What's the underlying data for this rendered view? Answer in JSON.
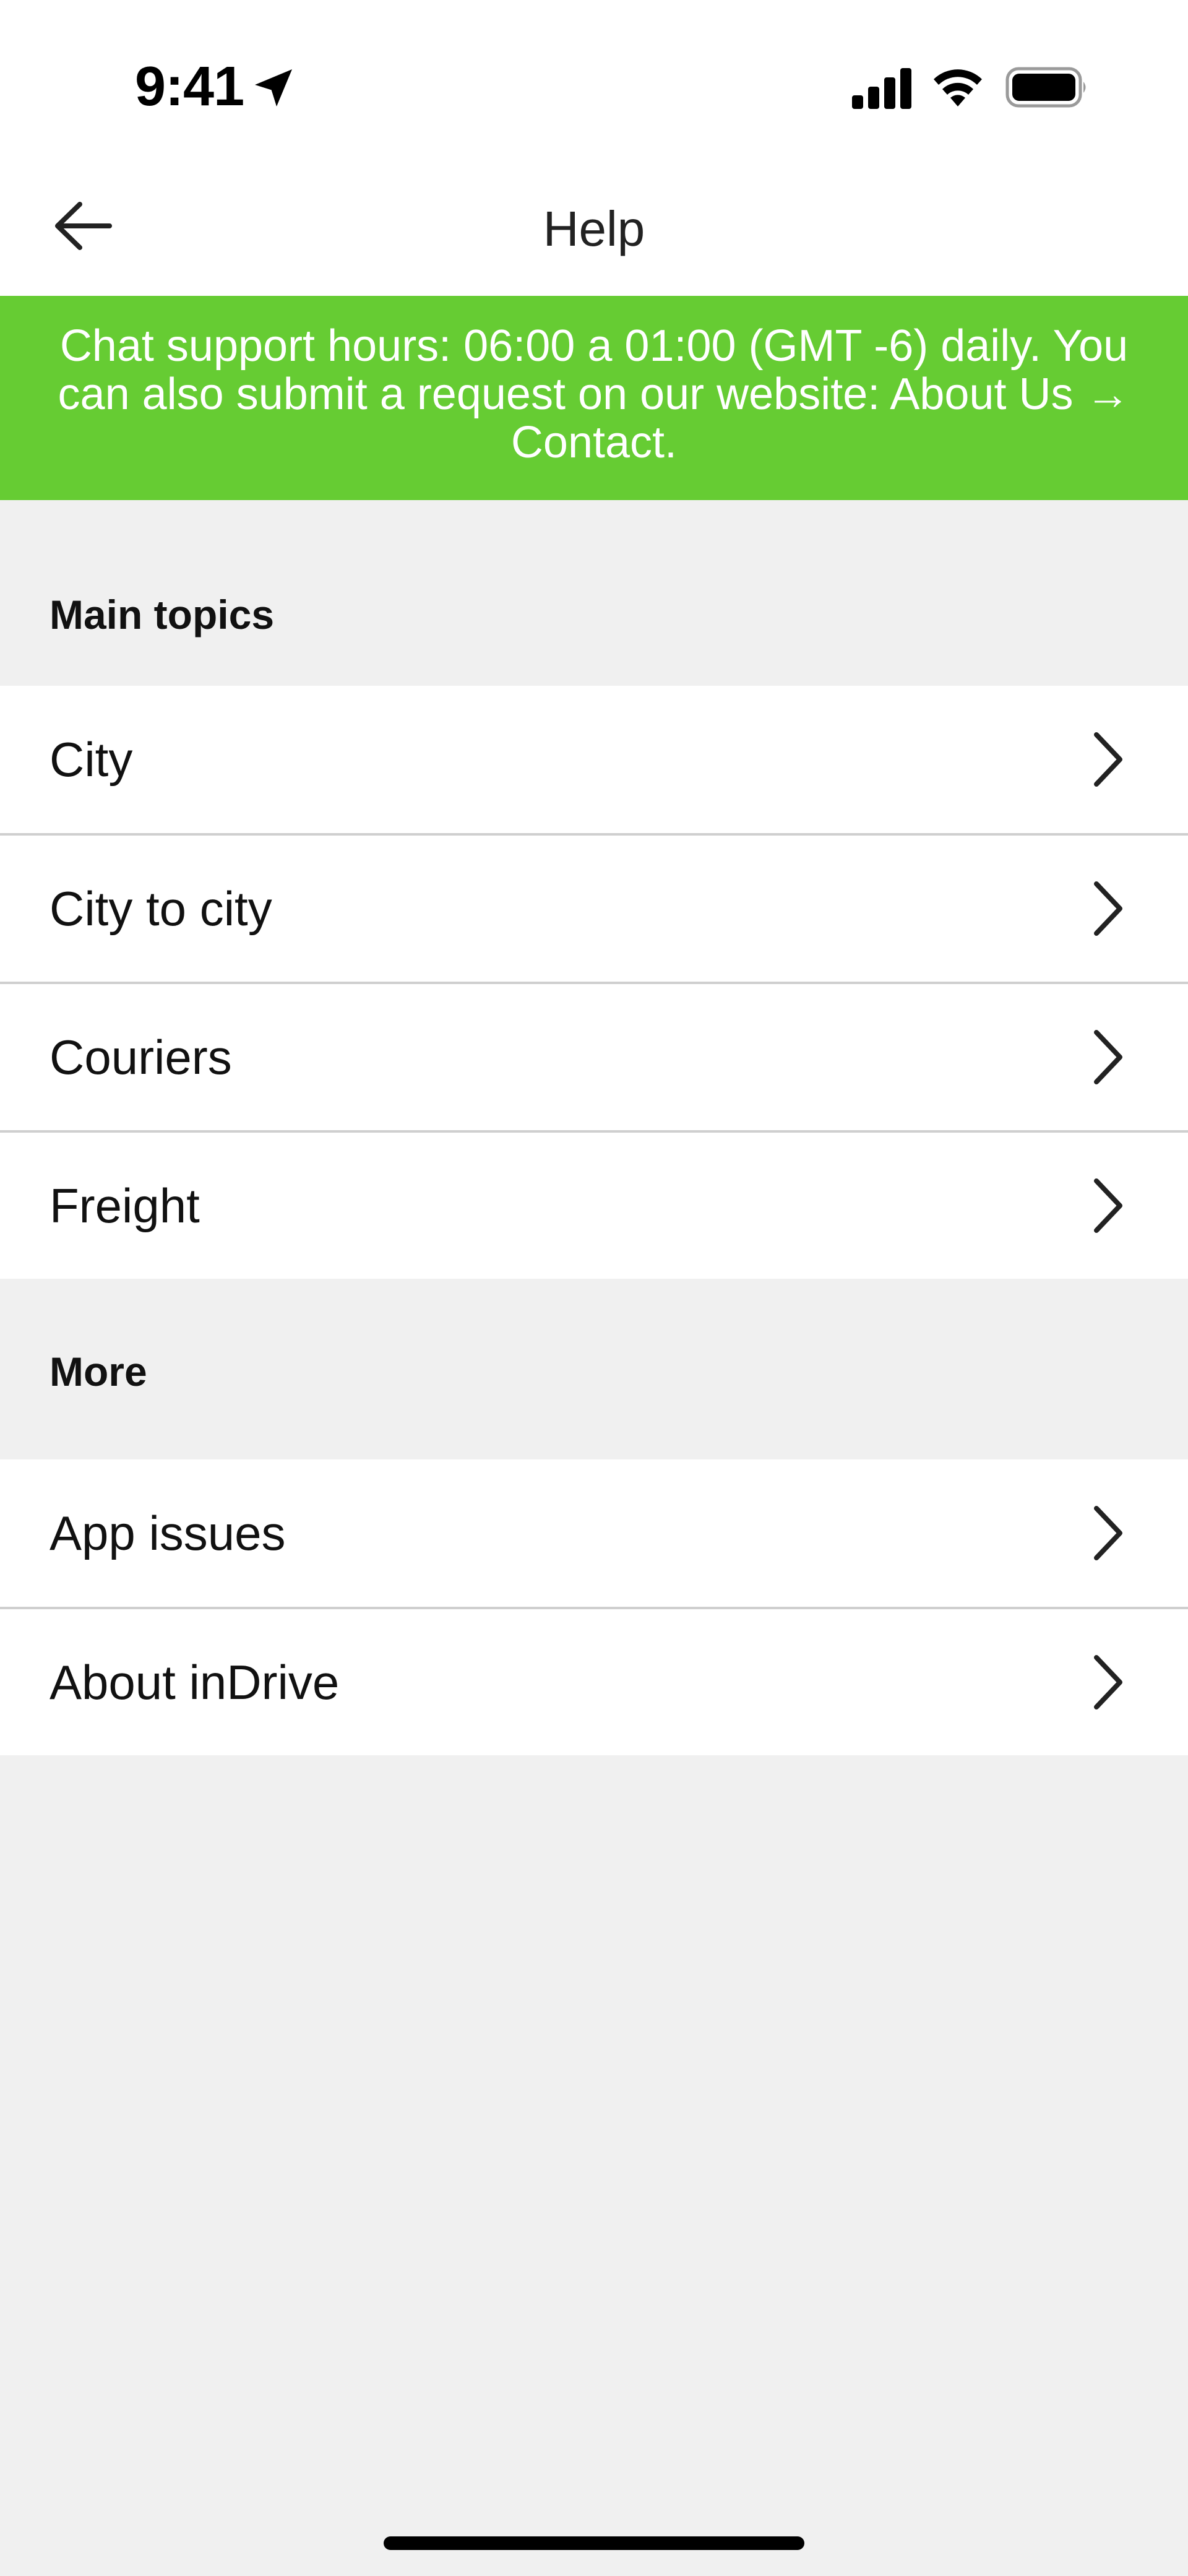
{
  "status_bar": {
    "time": "9:41",
    "icons": [
      "location-arrow-icon",
      "cellular-signal-icon",
      "wifi-icon",
      "battery-icon"
    ]
  },
  "header": {
    "title": "Help",
    "back_icon": "arrow-left-icon"
  },
  "banner": {
    "text": "Chat support hours: 06:00 a 01:00 (GMT -6) daily. You can also submit a request on our website: About Us → Contact.",
    "background_color": "#66cc33",
    "text_color": "#ffffff"
  },
  "sections": [
    {
      "title": "Main topics",
      "items": [
        {
          "label": "City",
          "icon": "chevron-right-icon"
        },
        {
          "label": "City to city",
          "icon": "chevron-right-icon"
        },
        {
          "label": "Couriers",
          "icon": "chevron-right-icon"
        },
        {
          "label": "Freight",
          "icon": "chevron-right-icon"
        }
      ]
    },
    {
      "title": "More",
      "items": [
        {
          "label": "App issues",
          "icon": "chevron-right-icon"
        },
        {
          "label": "About inDrive",
          "icon": "chevron-right-icon"
        }
      ]
    }
  ],
  "colors": {
    "page_background": "#f0f0f0",
    "list_background": "#ffffff",
    "divider": "#cfcfcf"
  }
}
